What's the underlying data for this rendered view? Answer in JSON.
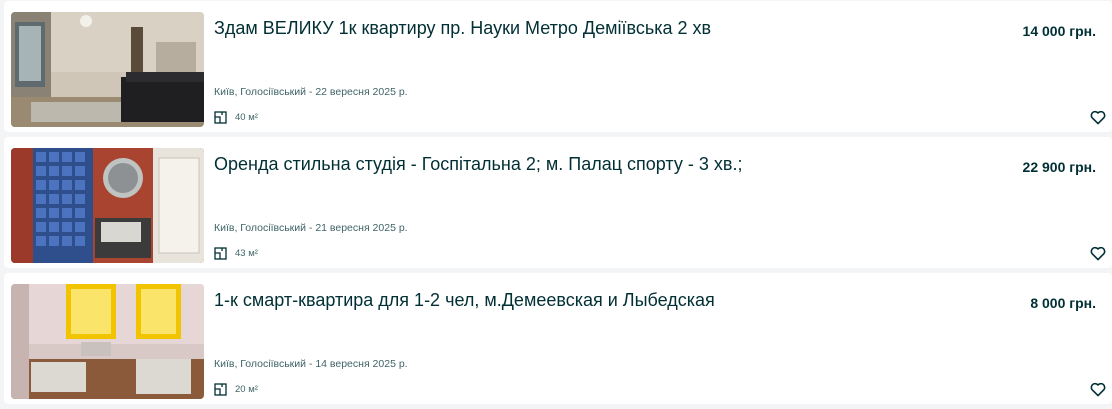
{
  "listings": [
    {
      "title": "Здам ВЕЛИКУ 1к квартиру пр. Науки Метро Деміївська 2 хв",
      "price": "14 000 грн.",
      "location_date": "Київ, Голосіївський - 22 вересня 2025 р.",
      "area": "40 м²",
      "area_icon": "floor-plan-icon",
      "favorite_icon": "heart-outline-icon"
    },
    {
      "title": "Оренда стильна студія - Госпітальна 2; м. Палац спорту - 3 хв.;",
      "price": "22 900 грн.",
      "location_date": "Київ, Голосіївський - 21 вересня 2025 р.",
      "area": "43 м²",
      "area_icon": "floor-plan-icon",
      "favorite_icon": "heart-outline-icon"
    },
    {
      "title": "1-к смарт-квартира для 1-2 чел, м.Демеевская и Лыбедская",
      "price": "8 000 грн.",
      "location_date": "Київ, Голосіївський - 14 вересня 2025 р.",
      "area": "20 м²",
      "area_icon": "floor-plan-icon",
      "favorite_icon": "heart-outline-icon"
    }
  ],
  "colors": {
    "page_background": "#f2f4f5",
    "card_background": "#ffffff",
    "text_primary": "#002f34",
    "text_secondary": "#406367"
  }
}
